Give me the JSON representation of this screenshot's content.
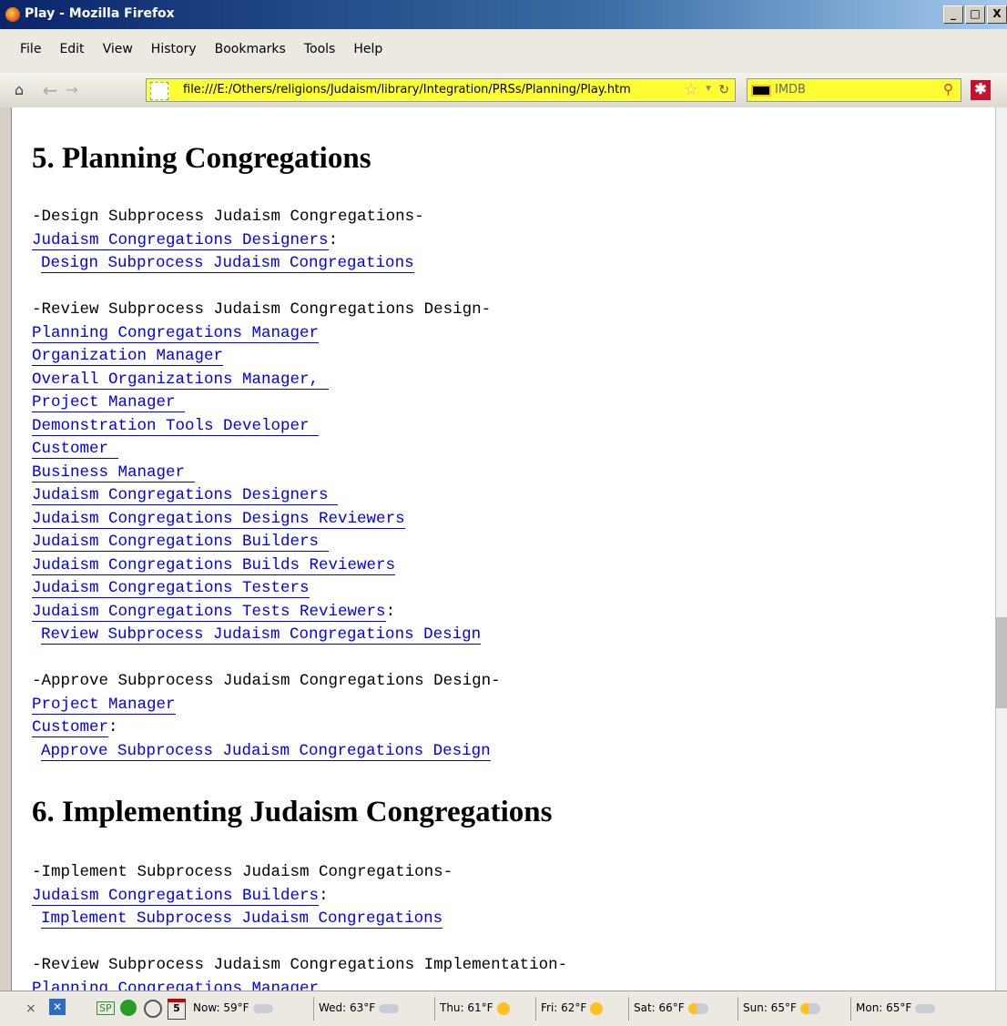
{
  "window": {
    "title": "Play - Mozilla Firefox",
    "controls": [
      "_",
      "□",
      "X"
    ]
  },
  "menu": [
    "File",
    "Edit",
    "View",
    "History",
    "Bookmarks",
    "Tools",
    "Help"
  ],
  "navbar": {
    "url": "file:///E:/Others/religions/Judaism/library/Integration/PRSs/Planning/Play.htm",
    "search_placeholder": "IMDB"
  },
  "content": {
    "h5": "5. Planning Congregations",
    "s1_head": "-Design Subprocess Judaism Congregations-",
    "s1_link1": "Judaism Congregations Designers",
    "s1_sub": "Design Subprocess Judaism Congregations",
    "s2_head": "-Review Subprocess Judaism Congregations Design-",
    "s2_links": [
      "Planning Congregations Manager",
      "Organization Manager",
      "Overall Organizations Manager, ",
      "Project Manager ",
      "Demonstration Tools Developer ",
      "Customer ",
      "Business Manager ",
      "Judaism Congregations Designers ",
      "Judaism Congregations Designs Reviewers",
      "Judaism Congregations Builders ",
      "Judaism Congregations Builds Reviewers",
      "Judaism Congregations Testers",
      "Judaism Congregations Tests Reviewers"
    ],
    "s2_sub": "Review Subprocess Judaism Congregations Design",
    "s3_head": "-Approve Subprocess Judaism Congregations Design-",
    "s3_link1": "Project Manager",
    "s3_link2": "Customer",
    "s3_sub": "Approve Subprocess Judaism Congregations Design",
    "h6": "6. Implementing Judaism Congregations",
    "s4_head": "-Implement Subprocess Judaism Congregations-",
    "s4_link1": "Judaism Congregations Builders",
    "s4_sub": "Implement Subprocess Judaism Congregations",
    "s5_head": "-Review Subprocess Judaism Congregations Implementation-",
    "s5_link1": "Planning Congregations Manager",
    "colon": ":"
  },
  "status": {
    "sp": "SP",
    "calendar_day": "5",
    "now": "Now: 59°F",
    "wed": "Wed: 63°F",
    "thu": "Thu: 61°F",
    "fri": "Fri: 62°F",
    "sat": "Sat: 66°F",
    "sun": "Sun: 65°F",
    "mon": "Mon: 65°F"
  }
}
